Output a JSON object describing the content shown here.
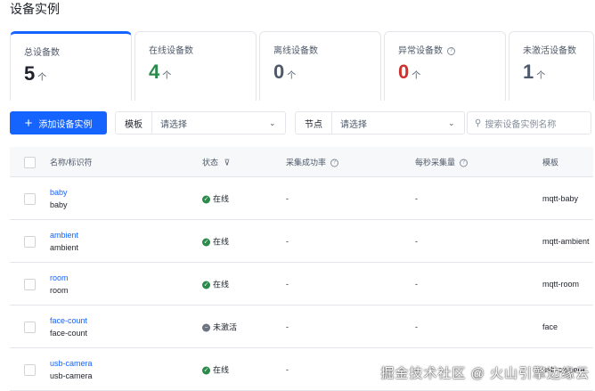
{
  "title": "设备实例",
  "stats": [
    {
      "label": "总设备数",
      "value": "5",
      "unit": "个",
      "color": "#1d2129"
    },
    {
      "label": "在线设备数",
      "value": "4",
      "unit": "个",
      "color": "#2a8a4a"
    },
    {
      "label": "离线设备数",
      "value": "0",
      "unit": "个",
      "color": "#4e5969"
    },
    {
      "label": "异常设备数",
      "value": "0",
      "unit": "个",
      "color": "#d0312d"
    },
    {
      "label": "未激活设备数",
      "value": "1",
      "unit": "个",
      "color": "#4e5969"
    }
  ],
  "toolbar": {
    "add_label": "添加设备实例",
    "template_label": "模板",
    "template_value": "请选择",
    "node_label": "节点",
    "node_value": "请选择",
    "search_placeholder": "搜索设备实例名称"
  },
  "table": {
    "headers": [
      "名称/标识符",
      "状态",
      "采集成功率",
      "每秒采集量",
      "模板"
    ],
    "rows": [
      {
        "name": "baby",
        "id": "baby",
        "status": "在线",
        "online": true,
        "rate": "-",
        "per_sec": "-",
        "template": "mqtt-baby"
      },
      {
        "name": "ambient",
        "id": "ambient",
        "status": "在线",
        "online": true,
        "rate": "-",
        "per_sec": "-",
        "template": "mqtt-ambient"
      },
      {
        "name": "room",
        "id": "room",
        "status": "在线",
        "online": true,
        "rate": "-",
        "per_sec": "-",
        "template": "mqtt-room"
      },
      {
        "name": "face-count",
        "id": "face-count",
        "status": "未激活",
        "online": false,
        "rate": "-",
        "per_sec": "-",
        "template": "face"
      },
      {
        "name": "usb-camera",
        "id": "usb-camera",
        "status": "在线",
        "online": true,
        "rate": "-",
        "per_sec": "-",
        "template": "usb-camera"
      }
    ]
  },
  "watermark": "掘金技术社区 @ 火山引擎边缘云"
}
